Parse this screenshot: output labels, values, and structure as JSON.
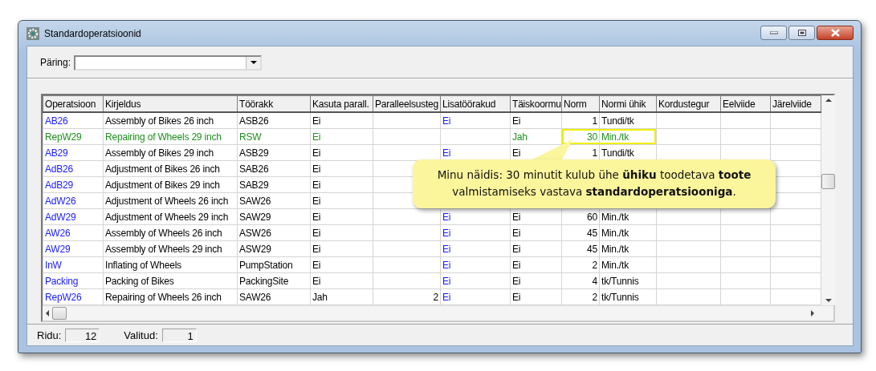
{
  "window": {
    "title": "Standardoperatsioonid"
  },
  "query": {
    "label": "Päring:"
  },
  "table": {
    "columns": [
      {
        "label": "Operatsioon",
        "kind": "link"
      },
      {
        "label": "Kirjeldus",
        "kind": "text"
      },
      {
        "label": "Töörakk",
        "kind": "text"
      },
      {
        "label": "Kasuta parall.",
        "kind": "text"
      },
      {
        "label": "Paralleelsusteg",
        "kind": "number"
      },
      {
        "label": "Lisatöörakud",
        "kind": "link"
      },
      {
        "label": "Täiskoormu",
        "kind": "text"
      },
      {
        "label": "Norm",
        "kind": "number"
      },
      {
        "label": "Normi ühik",
        "kind": "text"
      },
      {
        "label": "Kordustegur"
      },
      {
        "label": "Eelviide"
      },
      {
        "label": "Järelviide"
      }
    ],
    "rows": [
      {
        "selected": false,
        "cells": [
          "AB26",
          "Assembly of Bikes 26 inch",
          "ASB26",
          "Ei",
          null,
          "Ei",
          "Ei",
          "1",
          "Tundi/tk"
        ]
      },
      {
        "selected": true,
        "framed": true,
        "cells": [
          "RepW29",
          "Repairing of Wheels 29 inch",
          "RSW",
          "Ei",
          null,
          null,
          "Jah",
          "30",
          "Min./tk"
        ]
      },
      {
        "selected": false,
        "cells": [
          "AB29",
          "Assembly of Bikes 29 inch",
          "ASB29",
          "Ei",
          null,
          "Ei",
          "Ei",
          "1",
          "Tundi/tk"
        ]
      },
      {
        "selected": false,
        "cells": [
          "AdB26",
          "Adjustment of Bikes 26 inch",
          "SAB26",
          "Ei"
        ]
      },
      {
        "selected": false,
        "cells": [
          "AdB29",
          "Adjustment of Bikes 29 inch",
          "SAB29",
          "Ei"
        ]
      },
      {
        "selected": false,
        "cells": [
          "AdW26",
          "Adjustment of Wheels 26 inch",
          "SAW26",
          "Ei"
        ]
      },
      {
        "selected": false,
        "cells": [
          "AdW29",
          "Adjustment of Wheels 29 inch",
          "SAW29",
          "Ei",
          null,
          "Ei",
          "Ei",
          "60",
          "Min./tk"
        ]
      },
      {
        "selected": false,
        "cells": [
          "AW26",
          "Assembly of Wheels 26 inch",
          "ASW26",
          "Ei",
          null,
          "Ei",
          "Ei",
          "45",
          "Min./tk"
        ]
      },
      {
        "selected": false,
        "cells": [
          "AW29",
          "Assembly of Wheels 29 inch",
          "ASW29",
          "Ei",
          null,
          "Ei",
          "Ei",
          "45",
          "Min./tk"
        ]
      },
      {
        "selected": false,
        "cells": [
          "InW",
          "Inflating of Wheels",
          "PumpStation",
          "Ei",
          null,
          "Ei",
          "Ei",
          "2",
          "Min./tk"
        ]
      },
      {
        "selected": false,
        "cells": [
          "Packing",
          "Packing of Bikes",
          "PackingSite",
          "Ei",
          null,
          "Ei",
          "Ei",
          "4",
          "tk/Tunnis"
        ]
      },
      {
        "selected": false,
        "cells": [
          "RepW26",
          "Repairing of Wheels 26 inch",
          "SAW26",
          "Jah",
          "2",
          "Ei",
          "Ei",
          "2",
          "tk/Tunnis"
        ]
      }
    ]
  },
  "callout": {
    "text": "Minu näidis: 30 minutit kulub ühe **ühiku** toodetava **toote** valmistamiseks vastava **standardoperatsiooniga**."
  },
  "status_bar": {
    "rows_label": "Ridu:",
    "rows_value": "12",
    "selected_label": "Valitud:",
    "selected_value": "1"
  }
}
